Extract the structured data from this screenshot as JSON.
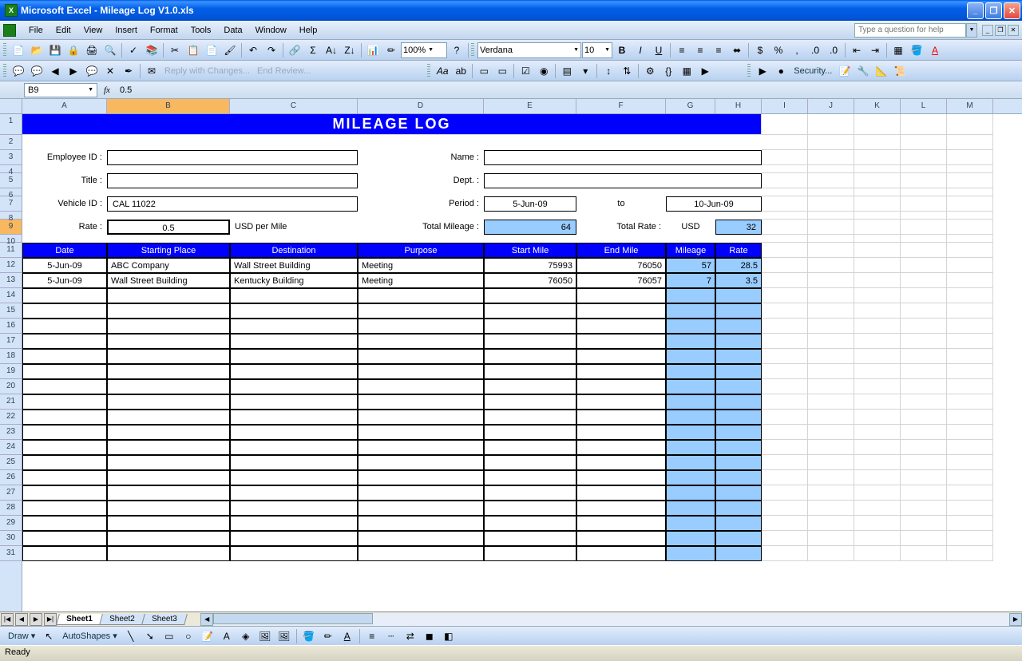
{
  "window": {
    "title": "Microsoft Excel - Mileage Log V1.0.xls"
  },
  "menu": {
    "items": [
      "File",
      "Edit",
      "View",
      "Insert",
      "Format",
      "Tools",
      "Data",
      "Window",
      "Help"
    ],
    "helpPlaceholder": "Type a question for help"
  },
  "toolbar": {
    "zoom": "100%",
    "font": "Verdana",
    "fontSize": "10",
    "replyLabel": "Reply with Changes...",
    "endReviewLabel": "End Review...",
    "securityLabel": "Security..."
  },
  "formulaBar": {
    "nameBox": "B9",
    "formula": "0.5"
  },
  "columns": [
    "A",
    "B",
    "C",
    "D",
    "E",
    "F",
    "G",
    "H",
    "I",
    "J",
    "K",
    "L",
    "M"
  ],
  "sheet": {
    "title": "MILEAGE LOG",
    "labels": {
      "employeeId": "Employee ID :",
      "name": "Name :",
      "title": "Title :",
      "dept": "Dept. :",
      "vehicleId": "Vehicle ID :",
      "period": "Period :",
      "to": "to",
      "rate": "Rate :",
      "rateUnit": "USD per Mile",
      "totalMileage": "Total Mileage :",
      "totalRate": "Total Rate :",
      "usd": "USD"
    },
    "fields": {
      "employeeId": "",
      "name": "",
      "title": "",
      "dept": "",
      "vehicleId": "CAL 11022",
      "periodFrom": "5-Jun-09",
      "periodTo": "10-Jun-09",
      "rate": "0.5",
      "totalMileage": "64",
      "totalRate": "32"
    },
    "tableHeaders": [
      "Date",
      "Starting Place",
      "Destination",
      "Purpose",
      "Start Mile",
      "End Mile",
      "Mileage",
      "Rate"
    ],
    "tableRows": [
      {
        "date": "5-Jun-09",
        "start": "ABC Company",
        "dest": "Wall Street Building",
        "purpose": "Meeting",
        "smile": "75993",
        "emile": "76050",
        "mileage": "57",
        "rate": "28.5"
      },
      {
        "date": "5-Jun-09",
        "start": "Wall Street Building",
        "dest": "Kentucky Building",
        "purpose": "Meeting",
        "smile": "76050",
        "emile": "76057",
        "mileage": "7",
        "rate": "3.5"
      }
    ]
  },
  "tabs": [
    "Sheet1",
    "Sheet2",
    "Sheet3"
  ],
  "drawbar": {
    "draw": "Draw",
    "autoshapes": "AutoShapes"
  },
  "status": "Ready"
}
